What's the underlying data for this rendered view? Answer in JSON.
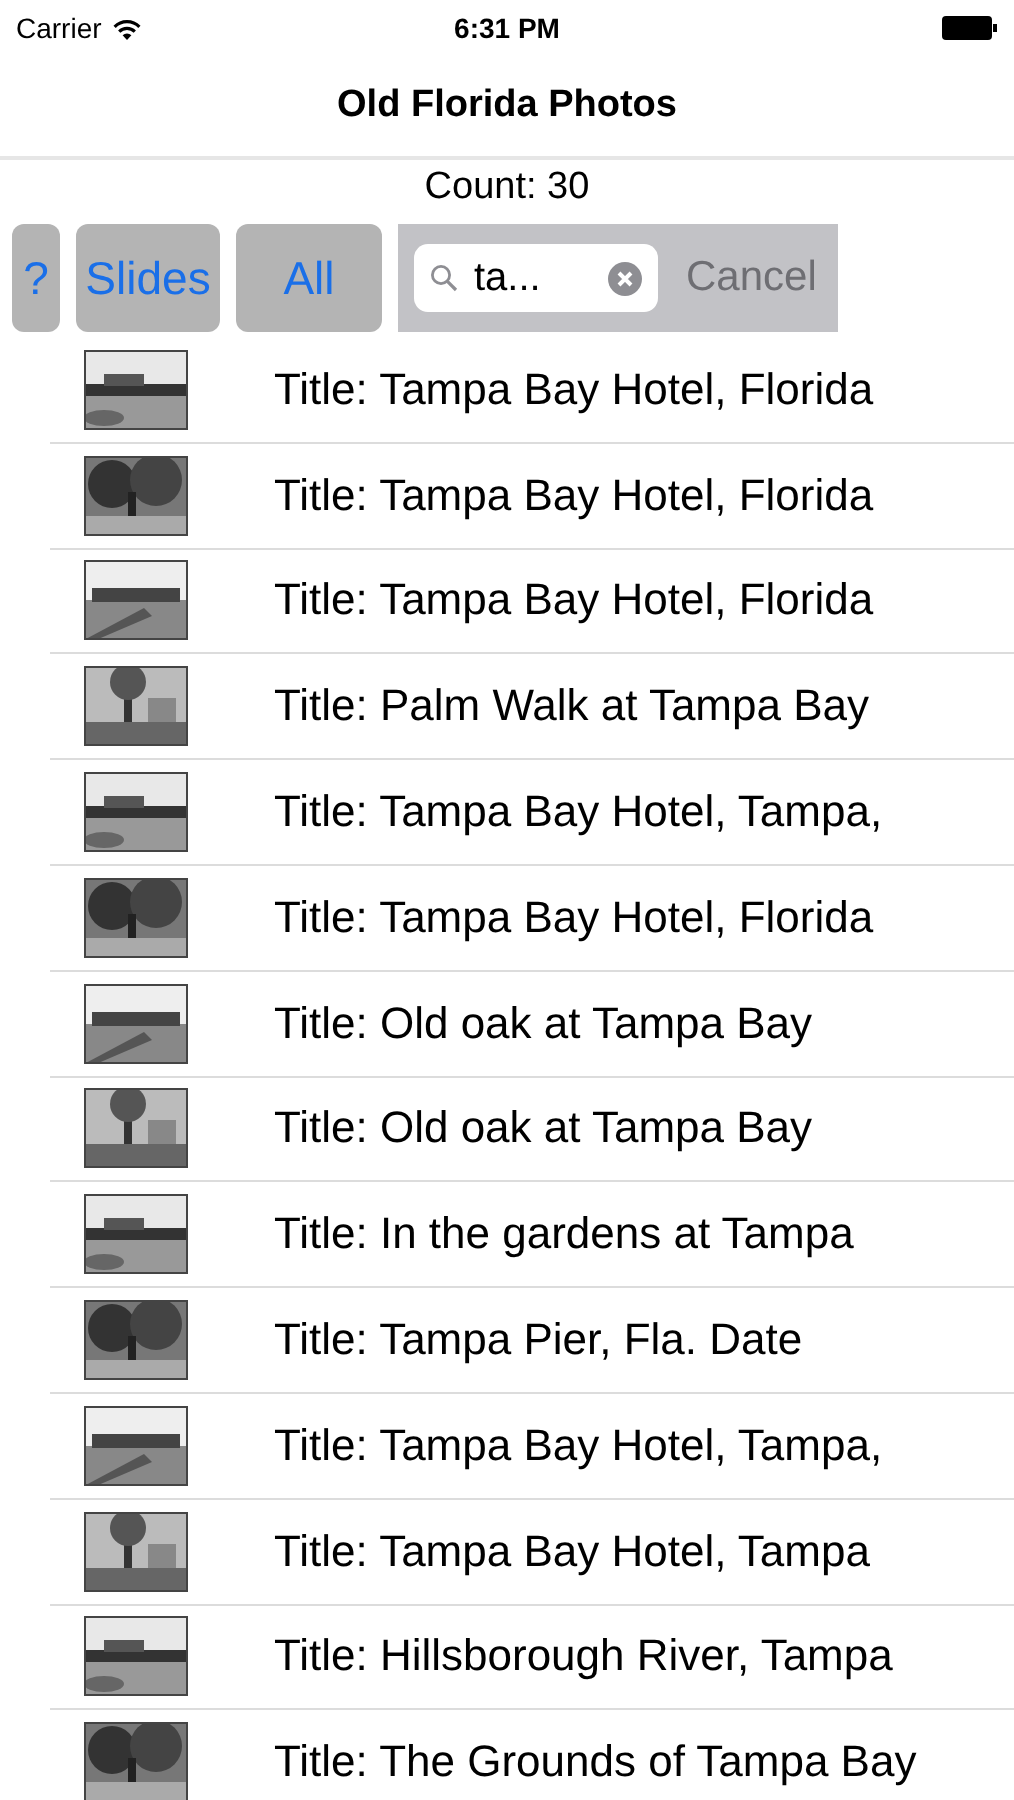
{
  "status_bar": {
    "carrier": "Carrier",
    "time": "6:31 PM"
  },
  "nav": {
    "title": "Old Florida Photos"
  },
  "count": "Count: 30",
  "toolbar": {
    "buttons": [
      {
        "label": "?"
      },
      {
        "label": "Slides"
      },
      {
        "label": "All"
      }
    ],
    "search": {
      "value": "ta...",
      "cancel": "Cancel",
      "cancel_disabled": true
    }
  },
  "rows": [
    {
      "title": "Title: Tampa Bay Hotel, Florida"
    },
    {
      "title": "Title: Tampa Bay Hotel, Florida"
    },
    {
      "title": "Title: Tampa Bay Hotel, Florida"
    },
    {
      "title": "Title: Palm Walk at Tampa Bay"
    },
    {
      "title": "Title: Tampa Bay Hotel, Tampa,"
    },
    {
      "title": "Title: Tampa Bay Hotel, Florida"
    },
    {
      "title": "Title: Old oak at Tampa Bay"
    },
    {
      "title": "Title: Old oak at Tampa Bay"
    },
    {
      "title": "Title: In the gardens at Tampa"
    },
    {
      "title": "Title: Tampa Pier, Fla. Date"
    },
    {
      "title": "Title: Tampa Bay Hotel, Tampa,"
    },
    {
      "title": "Title: Tampa Bay Hotel, Tampa"
    },
    {
      "title": "Title: Hillsborough River, Tampa"
    },
    {
      "title": "Title: The Grounds of Tampa Bay"
    }
  ]
}
